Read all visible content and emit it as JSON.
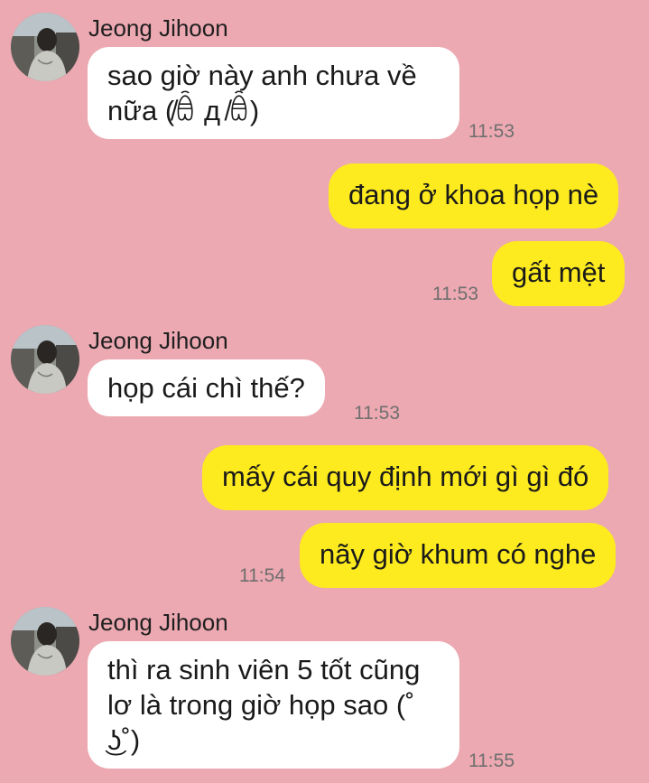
{
  "colors": {
    "background": "#eca9b2",
    "incoming_bubble": "#ffffff",
    "outgoing_bubble": "#fdeb1f",
    "timestamp": "#6f6f6f"
  },
  "messages": [
    {
      "direction": "in",
      "sender": "Jeong Jihoon",
      "text": "sao giờ này anh chưa về nữa (̸ꎁ д ̸ꎁ)",
      "time": "11:53"
    },
    {
      "direction": "out",
      "text": "đang ở khoa họp nè",
      "time": ""
    },
    {
      "direction": "out",
      "text": "gất mệt",
      "time": "11:53"
    },
    {
      "direction": "in",
      "sender": "Jeong Jihoon",
      "text": "họp cái chì thế?",
      "time": "11:53"
    },
    {
      "direction": "out",
      "text": "mấy cái quy định mới gì gì đó",
      "time": ""
    },
    {
      "direction": "out",
      "text": "nãy giờ khum có nghe",
      "time": "11:54"
    },
    {
      "direction": "in",
      "sender": "Jeong Jihoon",
      "text": "thì ra sinh viên 5 tốt cũng lơ là trong giờ họp sao (˚ ͜ʖ˚)",
      "time": "11:55"
    }
  ]
}
